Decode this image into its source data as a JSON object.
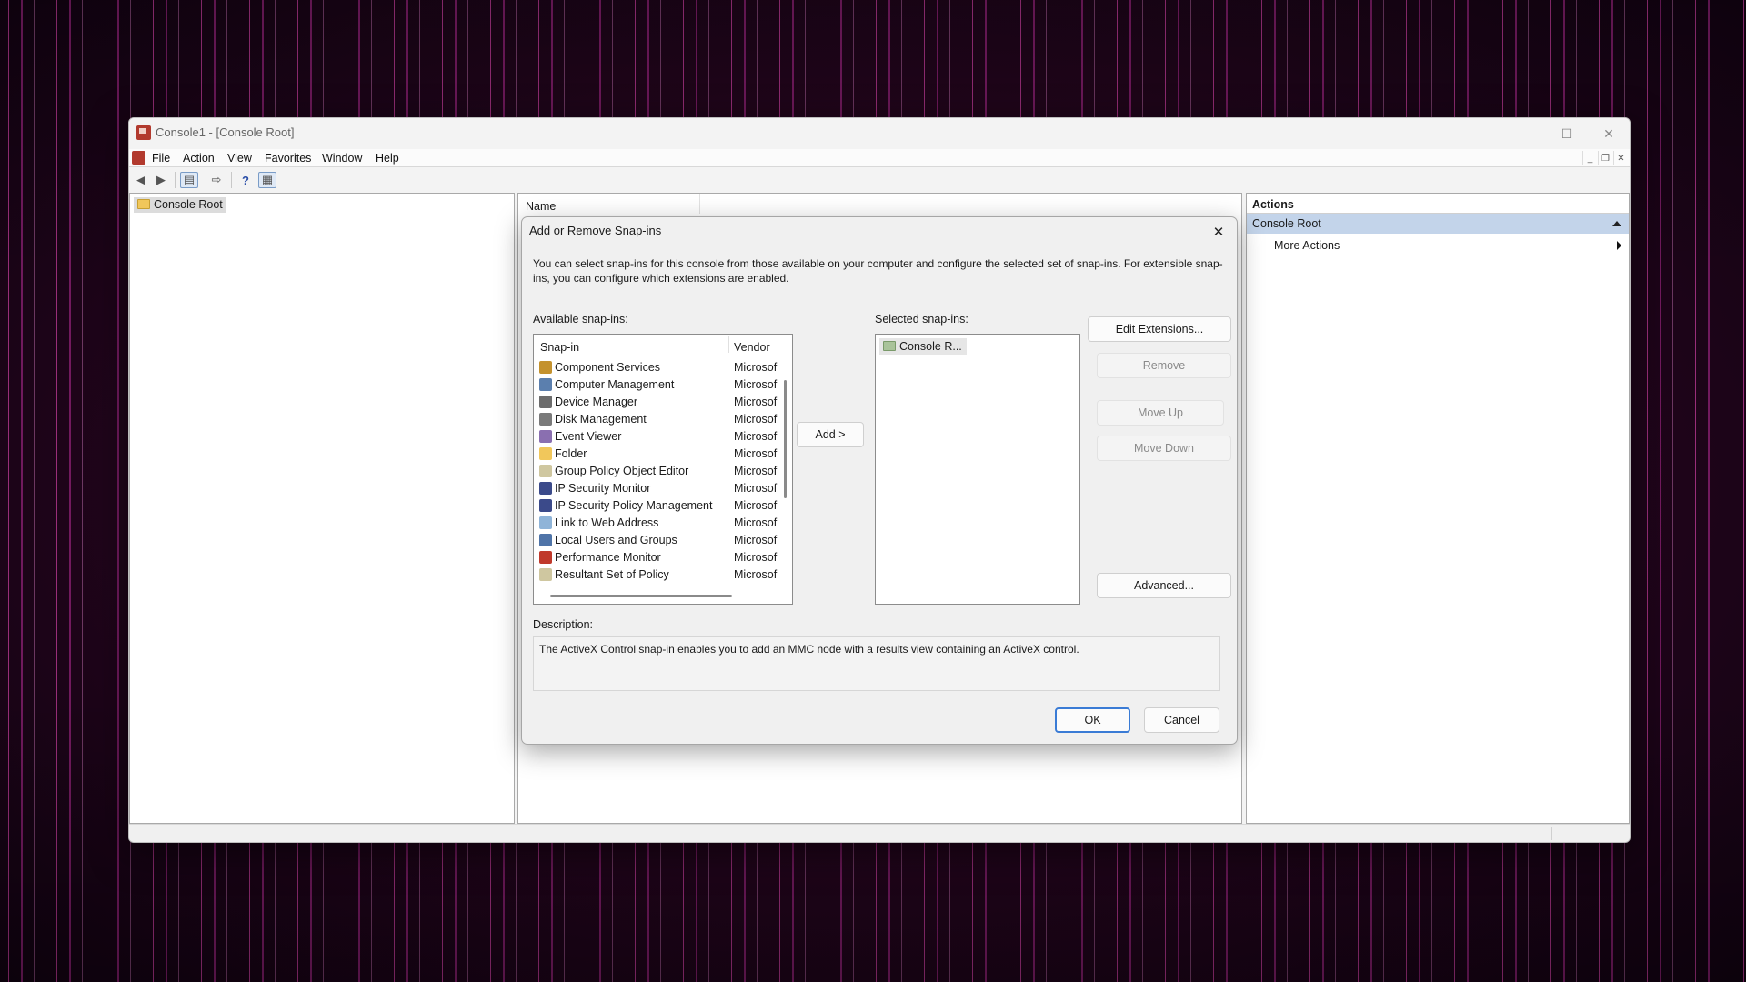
{
  "window": {
    "title": "Console1 - [Console Root]",
    "menu": [
      "File",
      "Action",
      "View",
      "Favorites",
      "Window",
      "Help"
    ],
    "tree_root": "Console Root",
    "center_column": "Name",
    "actions": {
      "header": "Actions",
      "section": "Console Root",
      "item": "More Actions"
    }
  },
  "dialog": {
    "title": "Add or Remove Snap-ins",
    "intro": "You can select snap-ins for this console from those available on your computer and configure the selected set of snap-ins. For extensible snap-ins, you can configure which extensions are enabled.",
    "available_label": "Available snap-ins:",
    "selected_label": "Selected snap-ins:",
    "columns": {
      "snapin": "Snap-in",
      "vendor": "Vendor"
    },
    "snapins": [
      {
        "name": "Component Services",
        "vendor": "Microsof",
        "icon": "component-services-icon",
        "color": "#c4922e"
      },
      {
        "name": "Computer Management",
        "vendor": "Microsof",
        "icon": "computer-management-icon",
        "color": "#5b7fae"
      },
      {
        "name": "Device Manager",
        "vendor": "Microsof",
        "icon": "device-manager-icon",
        "color": "#6c6c6c"
      },
      {
        "name": "Disk Management",
        "vendor": "Microsof",
        "icon": "disk-management-icon",
        "color": "#7a7a7a"
      },
      {
        "name": "Event Viewer",
        "vendor": "Microsof",
        "icon": "event-viewer-icon",
        "color": "#8a6fb0"
      },
      {
        "name": "Folder",
        "vendor": "Microsof",
        "icon": "folder-icon",
        "color": "#f1c75b"
      },
      {
        "name": "Group Policy Object Editor",
        "vendor": "Microsof",
        "icon": "group-policy-icon",
        "color": "#cfc7a0"
      },
      {
        "name": "IP Security Monitor",
        "vendor": "Microsof",
        "icon": "ip-security-monitor-icon",
        "color": "#3b4a8a"
      },
      {
        "name": "IP Security Policy Management",
        "vendor": "Microsof",
        "icon": "ip-security-policy-icon",
        "color": "#3b4a8a"
      },
      {
        "name": "Link to Web Address",
        "vendor": "Microsof",
        "icon": "web-link-icon",
        "color": "#8fb4d8"
      },
      {
        "name": "Local Users and Groups",
        "vendor": "Microsof",
        "icon": "users-groups-icon",
        "color": "#4f74a8"
      },
      {
        "name": "Performance Monitor",
        "vendor": "Microsof",
        "icon": "performance-monitor-icon",
        "color": "#c0392b"
      },
      {
        "name": "Resultant Set of Policy",
        "vendor": "Microsof",
        "icon": "resultant-policy-icon",
        "color": "#cfc7a0"
      }
    ],
    "selected": [
      "Console R..."
    ],
    "add_button": "Add >",
    "edit_extensions": "Edit Extensions...",
    "remove": "Remove",
    "move_up": "Move Up",
    "move_down": "Move Down",
    "advanced": "Advanced...",
    "description_label": "Description:",
    "description": "The ActiveX Control snap-in enables you to add an MMC node with a results view containing an ActiveX control.",
    "ok": "OK",
    "cancel": "Cancel"
  }
}
